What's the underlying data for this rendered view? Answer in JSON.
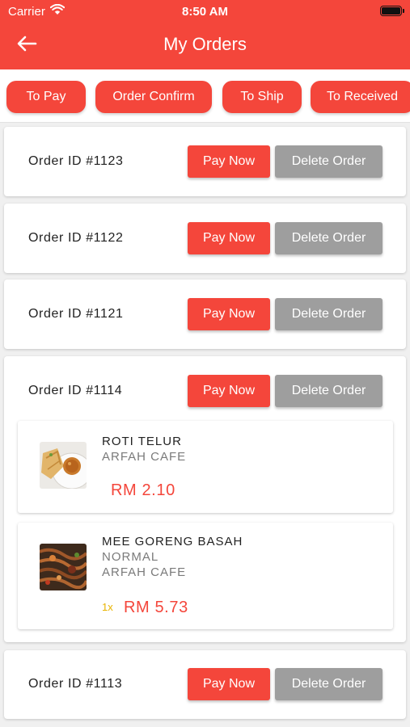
{
  "status_bar": {
    "carrier": "Carrier",
    "time": "8:50 AM"
  },
  "header": {
    "title": "My Orders",
    "back_icon": "arrow-left-icon"
  },
  "colors": {
    "accent": "#f4463b",
    "delete": "#9e9e9e",
    "qty": "#e8b400"
  },
  "tabs": [
    {
      "label": "To Pay"
    },
    {
      "label": "Order Confirm"
    },
    {
      "label": "To Ship"
    },
    {
      "label": "To Received"
    }
  ],
  "orders": [
    {
      "id_label": "Order ID #1123",
      "pay_label": "Pay Now",
      "delete_label": "Delete Order"
    },
    {
      "id_label": "Order ID #1122",
      "pay_label": "Pay Now",
      "delete_label": "Delete Order"
    },
    {
      "id_label": "Order ID #1121",
      "pay_label": "Pay Now",
      "delete_label": "Delete Order"
    },
    {
      "id_label": "Order ID #1114",
      "pay_label": "Pay Now",
      "delete_label": "Delete Order",
      "items": [
        {
          "name": "ROTI TELUR",
          "lines": [
            "ARFAH CAFE"
          ],
          "qty": "",
          "price": "RM 2.10"
        },
        {
          "name": "MEE GORENG BASAH",
          "lines": [
            "NORMAL",
            "ARFAH CAFE"
          ],
          "qty": "1x",
          "price": "RM 5.73"
        }
      ]
    },
    {
      "id_label": "Order ID #1113",
      "pay_label": "Pay Now",
      "delete_label": "Delete Order"
    }
  ]
}
